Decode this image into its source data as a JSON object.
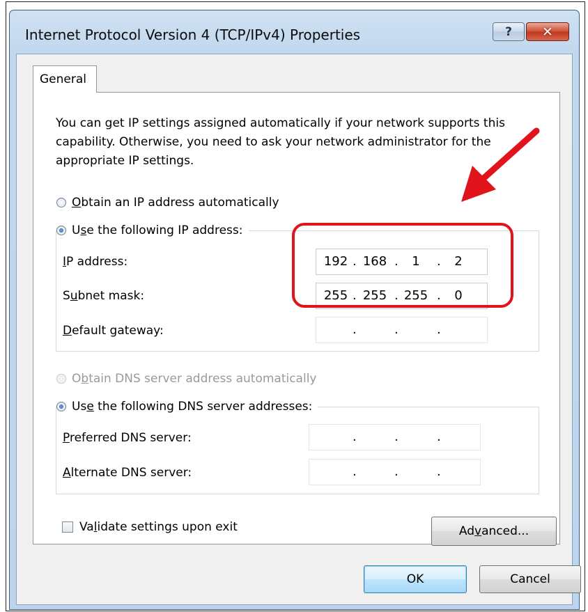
{
  "window": {
    "title": "Internet Protocol Version 4 (TCP/IPv4) Properties",
    "help_label": "?",
    "close_label": "✕"
  },
  "tabs": [
    {
      "label": "General"
    }
  ],
  "description": "You can get IP settings assigned automatically if your network supports this capability. Otherwise, you need to ask your network administrator for the appropriate IP settings.",
  "ip_section": {
    "auto_radio": {
      "pre": "",
      "u": "O",
      "post": "btain an IP address automatically",
      "checked": false
    },
    "manual_radio": {
      "pre": "U",
      "u": "s",
      "post": "e the following IP address:",
      "checked": true
    },
    "fields": [
      {
        "pre": "",
        "u": "I",
        "post": "P address:",
        "octets": [
          "192",
          "168",
          "1",
          "2"
        ]
      },
      {
        "pre": "S",
        "u": "u",
        "post": "bnet mask:",
        "octets": [
          "255",
          "255",
          "255",
          "0"
        ]
      },
      {
        "pre": "",
        "u": "D",
        "post": "efault gateway:",
        "octets": [
          "",
          "",
          "",
          ""
        ]
      }
    ]
  },
  "dns_section": {
    "auto_radio": {
      "pre": "O",
      "u": "b",
      "post": "tain DNS server address automatically",
      "checked": false,
      "disabled": true
    },
    "manual_radio": {
      "pre": "Us",
      "u": "e",
      "post": " the following DNS server addresses:",
      "checked": true
    },
    "fields": [
      {
        "pre": "",
        "u": "P",
        "post": "referred DNS server:",
        "octets": [
          "",
          "",
          "",
          ""
        ]
      },
      {
        "pre": "",
        "u": "A",
        "post": "lternate DNS server:",
        "octets": [
          "",
          "",
          "",
          ""
        ]
      }
    ]
  },
  "validate_checkbox": {
    "pre": "Va",
    "u": "l",
    "post": "idate settings upon exit",
    "checked": false
  },
  "buttons": {
    "advanced": {
      "pre": "Ad",
      "u": "v",
      "post": "anced..."
    },
    "ok": "OK",
    "cancel": "Cancel"
  },
  "colors": {
    "annotation": "#e2141b",
    "title_bar": "#c2d8ee"
  }
}
